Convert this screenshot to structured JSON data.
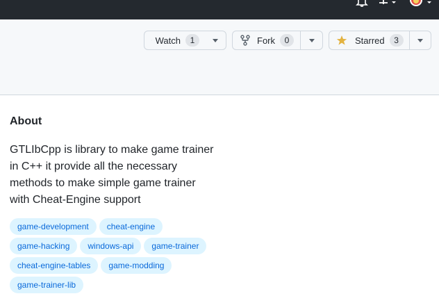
{
  "header": {
    "icons": [
      "bell-icon",
      "plus-icon",
      "avatar-icon"
    ]
  },
  "repo_actions": {
    "watch": {
      "label": "Watch",
      "count": "1",
      "icon": "eye-icon"
    },
    "fork": {
      "label": "Fork",
      "count": "0",
      "icon": "fork-icon"
    },
    "starred": {
      "label": "Starred",
      "count": "3",
      "icon": "star-icon",
      "icon_color": "#e3b341"
    }
  },
  "about": {
    "title": "About",
    "description": "GTLIbCpp is library to make game trainer in C++ it provide all the necessary methods to make simple game trainer with Cheat-Engine support",
    "topics": [
      "game-development",
      "cheat-engine",
      "game-hacking",
      "windows-api",
      "game-trainer",
      "cheat-engine-tables",
      "game-modding",
      "game-trainer-lib"
    ]
  },
  "colors": {
    "topbar": "#24292f",
    "topic_bg": "#ddf4ff",
    "topic_text": "#0969da"
  }
}
